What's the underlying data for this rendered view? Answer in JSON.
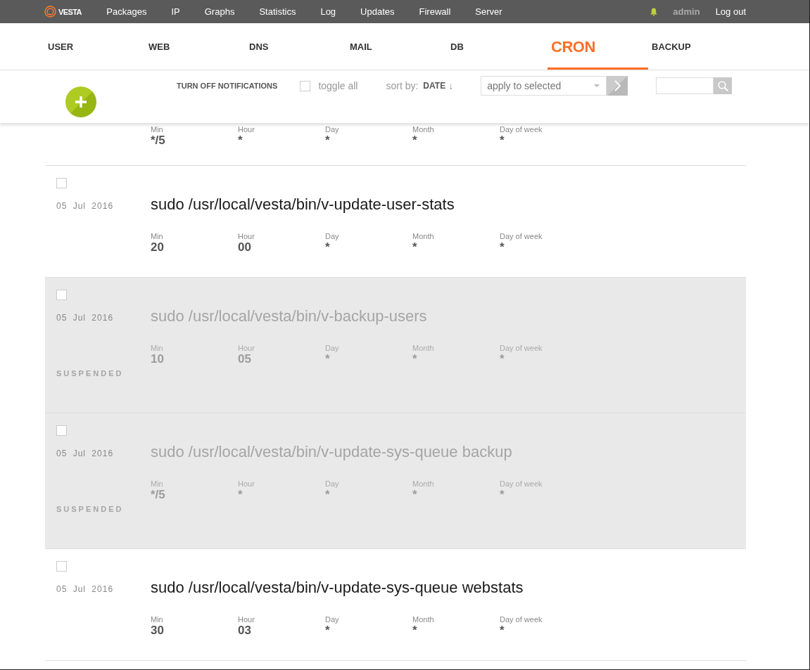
{
  "top_bar": {
    "logo": "VESTA",
    "nav": [
      "Packages",
      "IP",
      "Graphs",
      "Statistics",
      "Log",
      "Updates",
      "Firewall",
      "Server"
    ],
    "user": "admin",
    "logout": "Log out"
  },
  "tabs": [
    {
      "label": "USER",
      "selected": false
    },
    {
      "label": "WEB",
      "selected": false
    },
    {
      "label": "DNS",
      "selected": false
    },
    {
      "label": "MAIL",
      "selected": false
    },
    {
      "label": "DB",
      "selected": false
    },
    {
      "label": "CRON",
      "selected": true
    },
    {
      "label": "BACKUP",
      "selected": false
    }
  ],
  "toolbar": {
    "notifications": "TURN OFF NOTIFICATIONS",
    "toggle_all": {
      "label": "toggle all",
      "checked": false
    },
    "sort": {
      "label": "sort by:",
      "field": "DATE",
      "arrow": "↓"
    },
    "bulk_action": {
      "value": "apply to selected"
    }
  },
  "cut_off_job": {
    "schedule": [
      {
        "label": "Min",
        "value": "*/5"
      },
      {
        "label": "Hour",
        "value": "*"
      },
      {
        "label": "Day",
        "value": "*"
      },
      {
        "label": "Month",
        "value": "*"
      },
      {
        "label": "Day of week",
        "value": "*"
      }
    ]
  },
  "jobs": [
    {
      "checked": false,
      "suspended": false,
      "date": "05 Jul 2016",
      "command": "sudo /usr/local/vesta/bin/v-update-user-stats",
      "schedule": [
        {
          "label": "Min",
          "value": "20"
        },
        {
          "label": "Hour",
          "value": "00"
        },
        {
          "label": "Day",
          "value": "*"
        },
        {
          "label": "Month",
          "value": "*"
        },
        {
          "label": "Day of week",
          "value": "*"
        }
      ]
    },
    {
      "checked": false,
      "suspended": true,
      "status": "SUSPENDED",
      "date": "05 Jul 2016",
      "command": "sudo /usr/local/vesta/bin/v-backup-users",
      "schedule": [
        {
          "label": "Min",
          "value": "10"
        },
        {
          "label": "Hour",
          "value": "05"
        },
        {
          "label": "Day",
          "value": "*"
        },
        {
          "label": "Month",
          "value": "*"
        },
        {
          "label": "Day of week",
          "value": "*"
        }
      ]
    },
    {
      "checked": false,
      "suspended": true,
      "status": "SUSPENDED",
      "date": "05 Jul 2016",
      "command": "sudo /usr/local/vesta/bin/v-update-sys-queue backup",
      "schedule": [
        {
          "label": "Min",
          "value": "*/5"
        },
        {
          "label": "Hour",
          "value": "*"
        },
        {
          "label": "Day",
          "value": "*"
        },
        {
          "label": "Month",
          "value": "*"
        },
        {
          "label": "Day of week",
          "value": "*"
        }
      ]
    },
    {
      "checked": false,
      "suspended": false,
      "date": "05 Jul 2016",
      "command": "sudo /usr/local/vesta/bin/v-update-sys-queue webstats",
      "schedule": [
        {
          "label": "Min",
          "value": "30"
        },
        {
          "label": "Hour",
          "value": "03"
        },
        {
          "label": "Day",
          "value": "*"
        },
        {
          "label": "Month",
          "value": "*"
        },
        {
          "label": "Day of week",
          "value": "*"
        }
      ]
    }
  ]
}
